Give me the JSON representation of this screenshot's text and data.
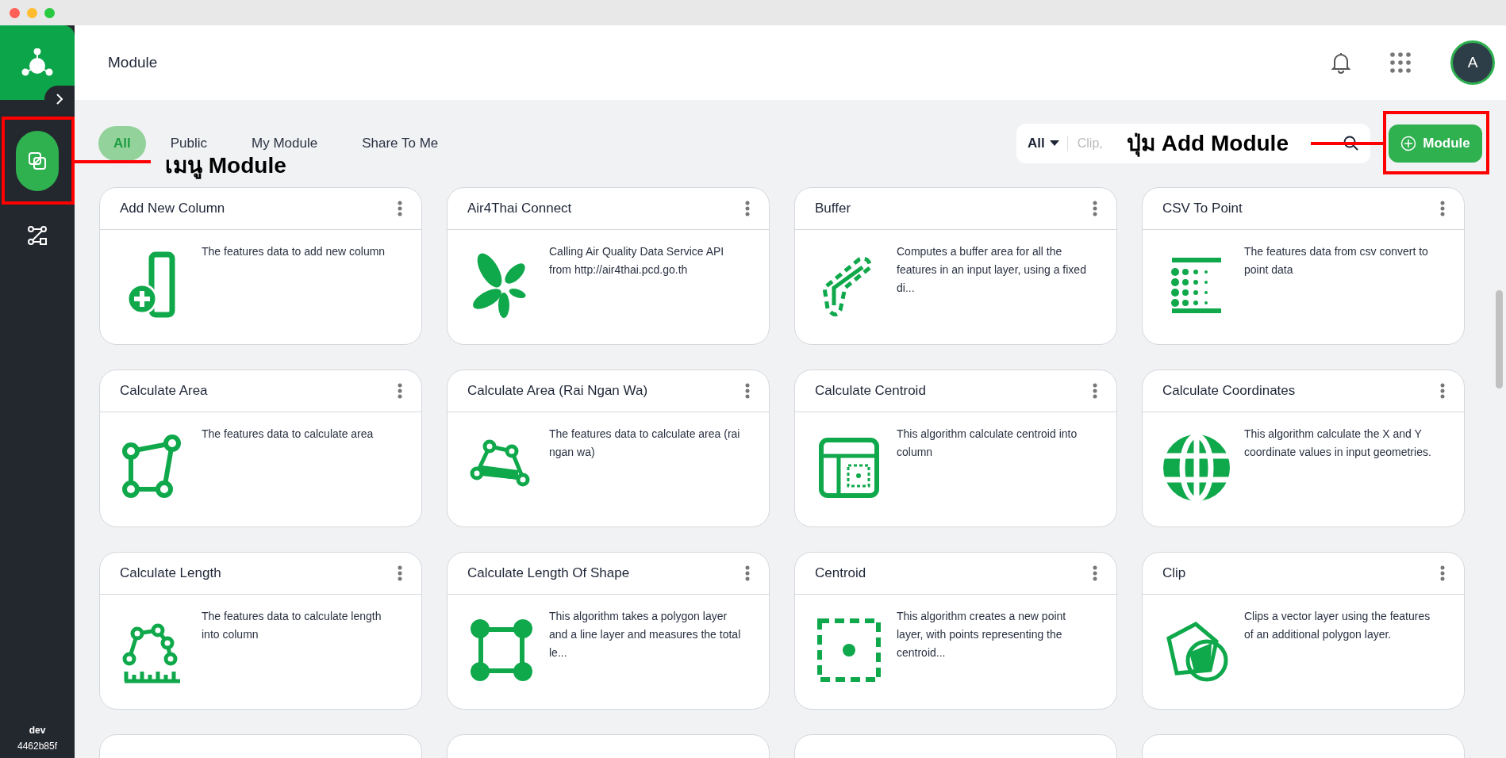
{
  "sidebar": {
    "nav": [
      {
        "kind": "module",
        "selected": true
      },
      {
        "kind": "workflow",
        "selected": false
      }
    ],
    "env": "dev",
    "build": "4462b85f"
  },
  "header": {
    "title": "Module",
    "avatar": "A"
  },
  "tabs": [
    {
      "label": "All",
      "selected": true
    },
    {
      "label": "Public",
      "selected": false
    },
    {
      "label": "My Module",
      "selected": false
    },
    {
      "label": "Share To Me",
      "selected": false
    }
  ],
  "search": {
    "scope": "All",
    "placeholder": "Clip,"
  },
  "add_button": {
    "label": "Module"
  },
  "modules": [
    {
      "title": "Add New Column",
      "description": "The features data to add new column"
    },
    {
      "title": "Air4Thai Connect",
      "description": "Calling Air Quality Data Service API from http://air4thai.pcd.go.th"
    },
    {
      "title": "Buffer",
      "description": "Computes a buffer area for all the features in an input layer, using a fixed di..."
    },
    {
      "title": "CSV To Point",
      "description": "The features data from csv convert to point data"
    },
    {
      "title": "Calculate Area",
      "description": "The features data to calculate area"
    },
    {
      "title": "Calculate Area (Rai Ngan Wa)",
      "description": "The features data to calculate area (rai ngan wa)"
    },
    {
      "title": "Calculate Centroid",
      "description": "This algorithm calculate centroid into column"
    },
    {
      "title": "Calculate Coordinates",
      "description": "This algorithm calculate the X and Y coordinate values in input geometries."
    },
    {
      "title": "Calculate Length",
      "description": "The features data to calculate length into column"
    },
    {
      "title": "Calculate Length Of Shape",
      "description": "This algorithm takes a polygon layer and a line layer and measures the total le..."
    },
    {
      "title": "Centroid",
      "description": "This algorithm creates a new point layer, with points representing the centroid..."
    },
    {
      "title": "Clip",
      "description": "Clips a vector layer using the features of an additional polygon layer."
    }
  ],
  "annotations": [
    {
      "label": "เมนู Module"
    },
    {
      "label": "ปุ่ม Add Module"
    }
  ]
}
